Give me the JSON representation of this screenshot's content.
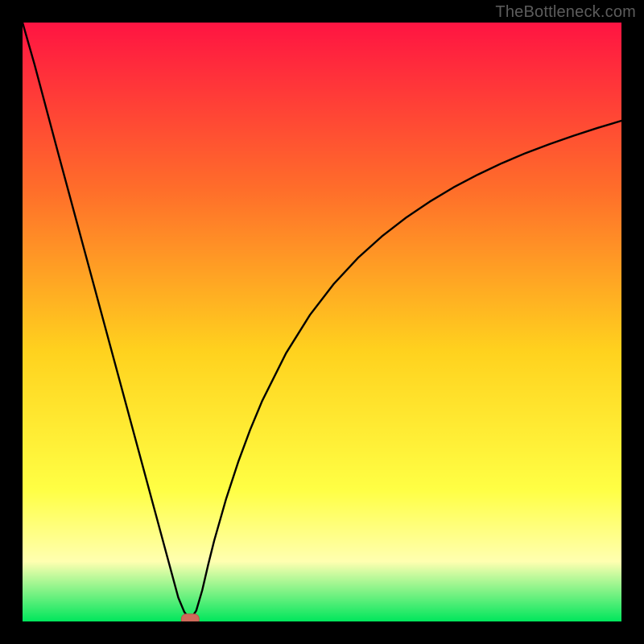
{
  "watermark": "TheBottleneck.com",
  "colors": {
    "frame": "#000000",
    "gradient_top": "#ff1442",
    "gradient_mid_up": "#ff6e2a",
    "gradient_mid": "#ffd21e",
    "gradient_low": "#ffff44",
    "gradient_pale": "#ffffb0",
    "gradient_bottom": "#00e65c",
    "curve": "#000000",
    "marker_fill": "#cf6a5a",
    "marker_stroke": "#b9564a"
  },
  "chart_data": {
    "type": "line",
    "title": "",
    "xlabel": "",
    "ylabel": "",
    "xlim": [
      0,
      100
    ],
    "ylim": [
      0,
      100
    ],
    "series": [
      {
        "name": "bottleneck-curve",
        "x": [
          0,
          2,
          4,
          6,
          8,
          10,
          12,
          14,
          16,
          18,
          20,
          22,
          24,
          26,
          27,
          28,
          29,
          30,
          31,
          32,
          34,
          36,
          38,
          40,
          44,
          48,
          52,
          56,
          60,
          64,
          68,
          72,
          76,
          80,
          84,
          88,
          92,
          96,
          100
        ],
        "y": [
          100,
          93,
          85.5,
          78,
          70.6,
          63.2,
          55.8,
          48.4,
          41,
          33.6,
          26.2,
          18.8,
          11.4,
          4,
          1.6,
          0.3,
          1.8,
          5.2,
          9.5,
          13.5,
          20.5,
          26.6,
          32,
          36.8,
          44.8,
          51.2,
          56.4,
          60.7,
          64.3,
          67.4,
          70.1,
          72.5,
          74.6,
          76.5,
          78.2,
          79.7,
          81.1,
          82.4,
          83.6
        ]
      }
    ],
    "marker": {
      "x": 28,
      "y": 0.3
    },
    "gradient_stops": [
      {
        "offset": 0.0,
        "color": "#ff1442"
      },
      {
        "offset": 0.28,
        "color": "#ff6e2a"
      },
      {
        "offset": 0.55,
        "color": "#ffd21e"
      },
      {
        "offset": 0.78,
        "color": "#ffff44"
      },
      {
        "offset": 0.9,
        "color": "#ffffb0"
      },
      {
        "offset": 1.0,
        "color": "#00e65c"
      }
    ]
  }
}
